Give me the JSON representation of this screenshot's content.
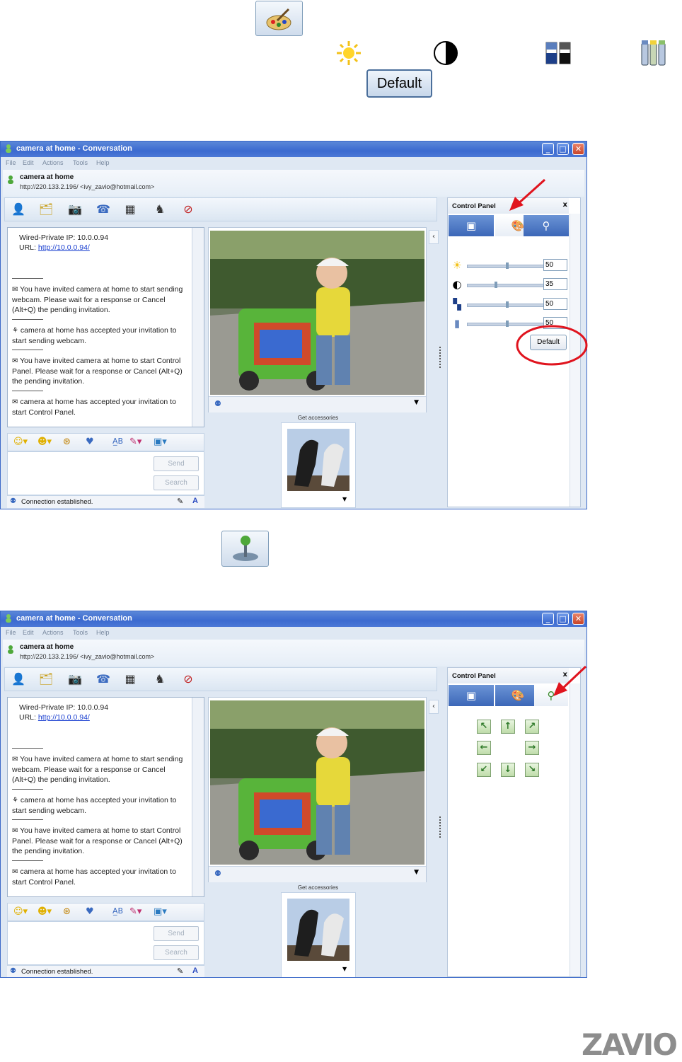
{
  "legend": {
    "default_button": "Default"
  },
  "window": {
    "title": "camera at home - Conversation",
    "menu": [
      "File",
      "Edit",
      "Actions",
      "Tools",
      "Help"
    ],
    "contact_name": "camera at home",
    "contact_address": "http://220.133.2.196/ <ivy_zavio@hotmail.com>",
    "chat": {
      "ip_line": "Wired-Private IP: 10.0.0.94",
      "url_label": "URL:",
      "url": "http://10.0.0.94/",
      "messages": [
        "You have invited camera at home to start sending webcam. Please wait for a response or Cancel (Alt+Q) the pending invitation.",
        "camera at home has accepted your invitation to start sending webcam.",
        "You have invited camera at home to start Control Panel. Please wait for a response or Cancel (Alt+Q) the pending invitation.",
        "camera at home has accepted your invitation to start Control Panel."
      ]
    },
    "send_button": "Send",
    "search_button": "Search",
    "status": "Connection established.",
    "accessories_label": "Get accessories",
    "control_panel": {
      "title": "Control Panel",
      "close": "x",
      "sliders": [
        {
          "icon": "brightness-icon",
          "value": "50",
          "level": 0.5
        },
        {
          "icon": "contrast-icon",
          "value": "35",
          "level": 0.35
        },
        {
          "icon": "saturation-icon",
          "value": "50",
          "level": 0.5
        },
        {
          "icon": "hue-icon",
          "value": "50",
          "level": 0.5
        }
      ],
      "default_button": "Default"
    }
  },
  "colors": {
    "title_bar": "#3b6ad0",
    "tab_active": "#4a74c4",
    "annotation": "#e0141e",
    "link": "#1a3fd0"
  },
  "logo": "ZAVIO"
}
